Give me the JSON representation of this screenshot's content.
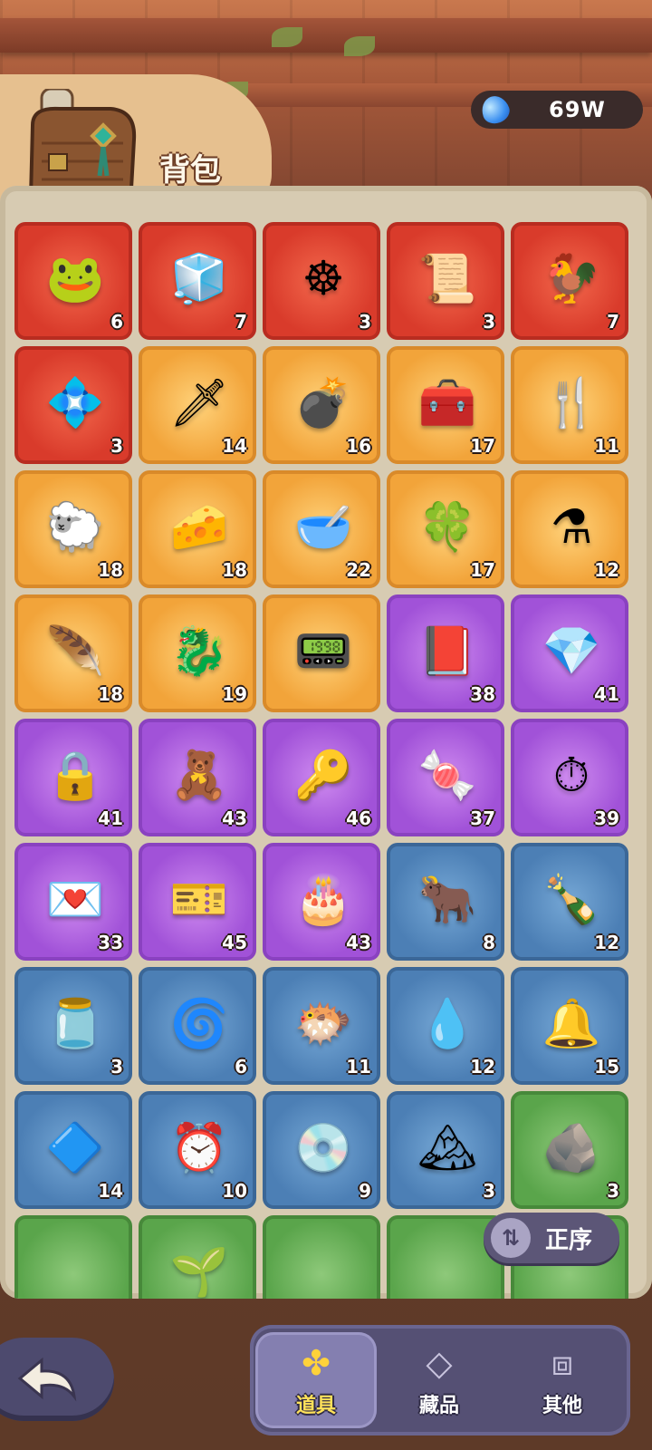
{
  "header": {
    "title": "背包",
    "currency": {
      "value": "69W",
      "icon": "gem-icon"
    }
  },
  "sort_button": {
    "label": "正序",
    "icon": "sort-arrows-icon"
  },
  "colors": {
    "red": "#d93b2b",
    "gold": "#f2a43a",
    "purple": "#a152d8",
    "blue": "#4c7fb5",
    "green": "#5aa54b"
  },
  "items": [
    {
      "name": "frog-orb",
      "rarity": "red",
      "glyph": "🐸",
      "count": "6"
    },
    {
      "name": "ice-cube",
      "rarity": "red",
      "glyph": "🧊",
      "count": "7"
    },
    {
      "name": "gold-wheel",
      "rarity": "red",
      "glyph": "☸",
      "count": "3"
    },
    {
      "name": "scroll",
      "rarity": "red",
      "glyph": "📜",
      "count": "3"
    },
    {
      "name": "rooster",
      "rarity": "red",
      "glyph": "🐓",
      "count": "7"
    },
    {
      "name": "blue-crystal",
      "rarity": "red",
      "glyph": "💠",
      "count": "3"
    },
    {
      "name": "dagger",
      "rarity": "gold",
      "glyph": "🗡",
      "count": "14"
    },
    {
      "name": "cannon",
      "rarity": "gold",
      "glyph": "💣",
      "count": "16"
    },
    {
      "name": "treasure-box",
      "rarity": "gold",
      "glyph": "🧰",
      "count": "17"
    },
    {
      "name": "fork",
      "rarity": "gold",
      "glyph": "🍴",
      "count": "11"
    },
    {
      "name": "gold-sheep",
      "rarity": "gold",
      "glyph": "🐑",
      "count": "18"
    },
    {
      "name": "cheese",
      "rarity": "gold",
      "glyph": "🧀",
      "count": "18"
    },
    {
      "name": "bowl",
      "rarity": "gold",
      "glyph": "🥣",
      "count": "22"
    },
    {
      "name": "clover-coin",
      "rarity": "gold",
      "glyph": "🍀",
      "count": "17"
    },
    {
      "name": "star-potion",
      "rarity": "gold",
      "glyph": "⚗",
      "count": "12"
    },
    {
      "name": "gold-wing",
      "rarity": "gold",
      "glyph": "🪶",
      "count": "18"
    },
    {
      "name": "gold-dragon",
      "rarity": "gold",
      "glyph": "🐉",
      "count": "19"
    },
    {
      "name": "gadget",
      "rarity": "gold",
      "glyph": "📟",
      "count": ""
    },
    {
      "name": "red-book",
      "rarity": "purple",
      "glyph": "📕",
      "count": "38"
    },
    {
      "name": "purple-gem",
      "rarity": "purple",
      "glyph": "💎",
      "count": "41"
    },
    {
      "name": "padlock",
      "rarity": "purple",
      "glyph": "🔒",
      "count": "41"
    },
    {
      "name": "teddy-bear",
      "rarity": "purple",
      "glyph": "🧸",
      "count": "43"
    },
    {
      "name": "silver-key",
      "rarity": "purple",
      "glyph": "🔑",
      "count": "46"
    },
    {
      "name": "candy",
      "rarity": "purple",
      "glyph": "🍬",
      "count": "37"
    },
    {
      "name": "stopwatch",
      "rarity": "purple",
      "glyph": "⏱",
      "count": "39"
    },
    {
      "name": "love-letter",
      "rarity": "purple",
      "glyph": "💌",
      "count": "33"
    },
    {
      "name": "vip-ticket",
      "rarity": "purple",
      "glyph": "🎫",
      "count": "45"
    },
    {
      "name": "cake",
      "rarity": "purple",
      "glyph": "🎂",
      "count": "43"
    },
    {
      "name": "ox-statue",
      "rarity": "blue",
      "glyph": "🐂",
      "count": "8"
    },
    {
      "name": "water-bottle",
      "rarity": "blue",
      "glyph": "🍾",
      "count": "12"
    },
    {
      "name": "jar",
      "rarity": "blue",
      "glyph": "🫙",
      "count": "3"
    },
    {
      "name": "swirl-charm",
      "rarity": "blue",
      "glyph": "🌀",
      "count": "6"
    },
    {
      "name": "puffer-fish",
      "rarity": "blue",
      "glyph": "🐡",
      "count": "11"
    },
    {
      "name": "water-drop",
      "rarity": "blue",
      "glyph": "💧",
      "count": "12"
    },
    {
      "name": "bell",
      "rarity": "blue",
      "glyph": "🔔",
      "count": "15"
    },
    {
      "name": "crystal-shard",
      "rarity": "blue",
      "glyph": "🔷",
      "count": "14"
    },
    {
      "name": "alarm-clock",
      "rarity": "blue",
      "glyph": "⏰",
      "count": "10"
    },
    {
      "name": "cd-disc",
      "rarity": "blue",
      "glyph": "💿",
      "count": "9"
    },
    {
      "name": "ice-mountain",
      "rarity": "blue",
      "glyph": "🏔",
      "count": "3"
    },
    {
      "name": "rune-stone",
      "rarity": "green",
      "glyph": "🪨",
      "count": "3"
    },
    {
      "name": "green-1",
      "rarity": "green",
      "glyph": "",
      "count": ""
    },
    {
      "name": "green-2",
      "rarity": "green",
      "glyph": "🌱",
      "count": ""
    },
    {
      "name": "green-3",
      "rarity": "green",
      "glyph": "",
      "count": ""
    },
    {
      "name": "green-4",
      "rarity": "green",
      "glyph": "",
      "count": ""
    },
    {
      "name": "green-5",
      "rarity": "green",
      "glyph": "",
      "count": ""
    }
  ],
  "tabs": [
    {
      "label": "道具",
      "icon": "clover-icon",
      "glyph": "✤",
      "active": true
    },
    {
      "label": "藏品",
      "icon": "diamond-icon",
      "glyph": "◇",
      "active": false
    },
    {
      "label": "其他",
      "icon": "box-icon",
      "glyph": "⧈",
      "active": false
    }
  ],
  "back_button": {
    "icon": "back-arrow-icon",
    "glyph": "↶"
  }
}
